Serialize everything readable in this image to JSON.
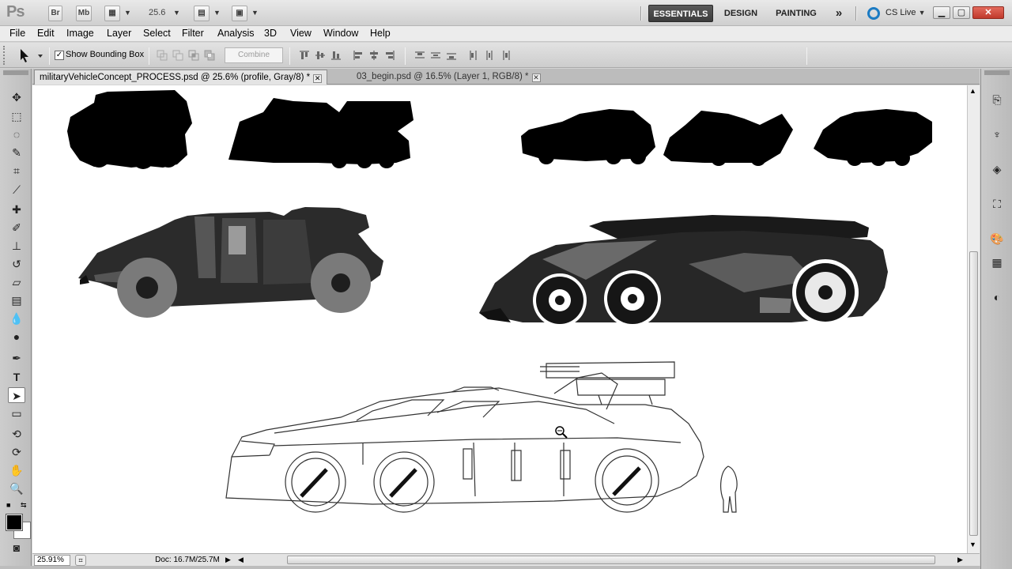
{
  "app": {
    "logo": "Ps",
    "bridge_label": "Br",
    "minibridge_label": "Mb",
    "zoom_value": "25.6",
    "workspaces": [
      "ESSENTIALS",
      "DESIGN",
      "PAINTING"
    ],
    "more_label": "»",
    "cslive_label": "CS Live"
  },
  "menu": [
    "File",
    "Edit",
    "Image",
    "Layer",
    "Select",
    "Filter",
    "Analysis",
    "3D",
    "View",
    "Window",
    "Help"
  ],
  "options": {
    "show_bounding_box": "Show Bounding Box",
    "combine": "Combine"
  },
  "tabs": [
    {
      "label": "militaryVehicleConcept_PROCESS.psd @ 25.6% (profile, Gray/8) *"
    },
    {
      "label": "03_begin.psd @ 16.5% (Layer 1, RGB/8) *"
    }
  ],
  "status": {
    "zoom": "25.91%",
    "doc": "Doc: 16.7M/25.7M"
  },
  "colors": {
    "foreground": "#000000",
    "background": "#ffffff",
    "workspace_active": "#3c3c3c"
  }
}
